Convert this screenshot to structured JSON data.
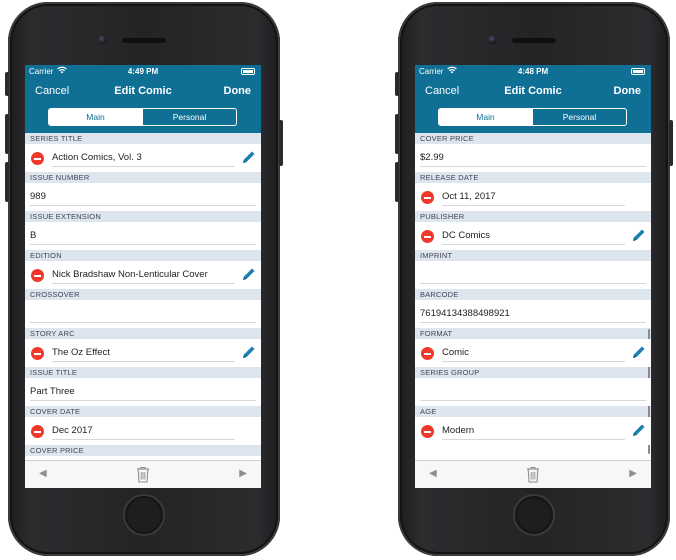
{
  "phones": [
    {
      "status": {
        "carrier": "Carrier",
        "time": "4:49 PM"
      },
      "nav": {
        "cancel": "Cancel",
        "title": "Edit Comic",
        "done": "Done"
      },
      "tabs": {
        "main": "Main",
        "personal": "Personal",
        "selected": "Main"
      },
      "fields": [
        {
          "label": "SERIES TITLE",
          "value": "Action Comics, Vol. 3",
          "removable": true,
          "editable": true
        },
        {
          "label": "ISSUE NUMBER",
          "value": "989",
          "removable": false,
          "editable": false
        },
        {
          "label": "ISSUE EXTENSION",
          "value": "B",
          "removable": false,
          "editable": false
        },
        {
          "label": "EDITION",
          "value": "Nick Bradshaw Non-Lenticular Cover",
          "removable": true,
          "editable": true
        },
        {
          "label": "CROSSOVER",
          "value": "",
          "removable": false,
          "editable": false
        },
        {
          "label": "STORY ARC",
          "value": "The Oz Effect",
          "removable": true,
          "editable": true
        },
        {
          "label": "ISSUE TITLE",
          "value": "Part Three",
          "removable": false,
          "editable": false
        },
        {
          "label": "COVER DATE",
          "value": "Dec 2017",
          "removable": true,
          "editable": false
        },
        {
          "label": "COVER PRICE",
          "value": "",
          "removable": false,
          "editable": false
        }
      ],
      "toolbar": {
        "prev": "◀",
        "next": "▶"
      }
    },
    {
      "status": {
        "carrier": "Carrier",
        "time": "4:48 PM"
      },
      "nav": {
        "cancel": "Cancel",
        "title": "Edit Comic",
        "done": "Done"
      },
      "tabs": {
        "main": "Main",
        "personal": "Personal",
        "selected": "Main"
      },
      "fields": [
        {
          "label": "COVER PRICE",
          "value": "$2.99",
          "removable": false,
          "editable": false
        },
        {
          "label": "RELEASE DATE",
          "value": "Oct 11, 2017",
          "removable": true,
          "editable": false
        },
        {
          "label": "PUBLISHER",
          "value": "DC Comics",
          "removable": true,
          "editable": true
        },
        {
          "label": "IMPRINT",
          "value": "",
          "removable": false,
          "editable": false
        },
        {
          "label": "BARCODE",
          "value": "76194134388498921",
          "removable": false,
          "editable": false
        },
        {
          "label": "FORMAT",
          "value": "Comic",
          "removable": true,
          "editable": true
        },
        {
          "label": "SERIES GROUP",
          "value": "",
          "removable": false,
          "editable": false
        },
        {
          "label": "AGE",
          "value": "Modern",
          "removable": true,
          "editable": true
        }
      ],
      "toolbar": {
        "prev": "◀",
        "next": "▶"
      }
    }
  ],
  "icons": {
    "remove": "minus-circle-icon",
    "edit": "pencil-icon",
    "delete": "trash-icon",
    "prev": "triangle-left-icon",
    "next": "triangle-right-icon",
    "wifi": "wifi-icon",
    "battery": "battery-icon"
  },
  "colors": {
    "nav_bar": "#0f6f95",
    "section_header": "#dde6ee",
    "remove_button": "#f0392b",
    "edit_icon": "#1b7fb2"
  }
}
